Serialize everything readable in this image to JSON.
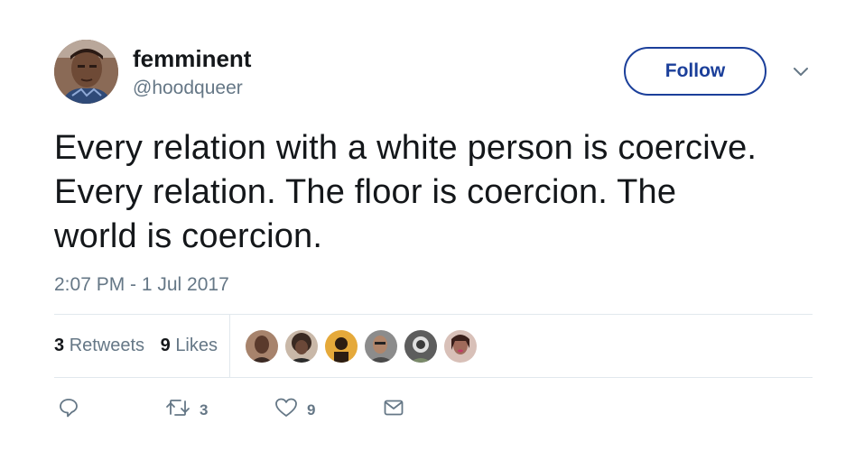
{
  "author": {
    "display_name": "femminent",
    "handle": "@hoodqueer",
    "avatar_icon": "user-avatar-photo"
  },
  "follow_button": {
    "label": "Follow",
    "color": "#1b3f9a"
  },
  "menu": {
    "icon": "chevron-down-icon"
  },
  "tweet": {
    "text": "Every relation with a white person is coercive.\nEvery relation. The floor is coercion. The\nworld is coercion.",
    "timestamp": "2:07 PM - 1 Jul 2017"
  },
  "stats": {
    "retweets_count": "3",
    "retweets_label": "Retweets",
    "likes_count": "9",
    "likes_label": "Likes"
  },
  "likers": [
    {
      "icon": "liker-avatar"
    },
    {
      "icon": "liker-avatar"
    },
    {
      "icon": "liker-avatar"
    },
    {
      "icon": "liker-avatar"
    },
    {
      "icon": "liker-avatar"
    },
    {
      "icon": "liker-avatar"
    }
  ],
  "actions": {
    "reply": {
      "icon": "reply-icon"
    },
    "retweet": {
      "icon": "retweet-icon",
      "count": "3"
    },
    "like": {
      "icon": "heart-icon",
      "count": "9"
    },
    "message": {
      "icon": "envelope-icon"
    }
  },
  "colors": {
    "text_primary": "#14171a",
    "text_secondary": "#657786",
    "divider": "#e1e8ed",
    "accent": "#1b3f9a"
  }
}
